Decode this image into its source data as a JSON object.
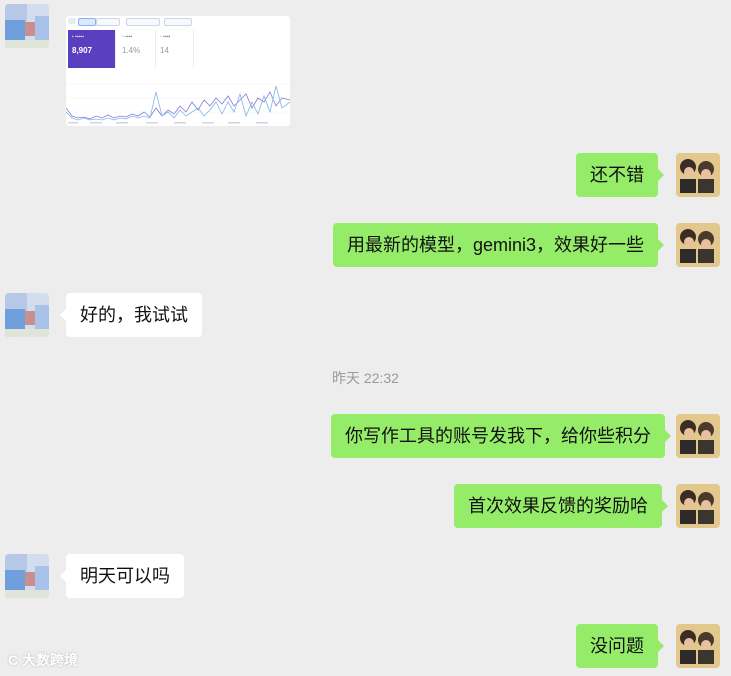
{
  "chat": {
    "messages": [
      {
        "id": 1,
        "side": "me",
        "text": "还不错"
      },
      {
        "id": 2,
        "side": "me",
        "text": "用最新的模型，gemini3，效果好一些"
      },
      {
        "id": 3,
        "side": "other",
        "text": "好的，我试试"
      },
      {
        "id": 4,
        "side": "me",
        "text": "你写作工具的账号发我下，给你些积分"
      },
      {
        "id": 5,
        "side": "me",
        "text": "首次效果反馈的奖励哈"
      },
      {
        "id": 6,
        "side": "other",
        "text": "明天可以吗"
      },
      {
        "id": 7,
        "side": "me",
        "text": "没问题"
      }
    ],
    "timestamp": "昨天 22:32"
  },
  "image_message": {
    "cards": [
      {
        "value": "8,907"
      },
      {
        "value": "1.4%"
      },
      {
        "value": "14"
      }
    ]
  },
  "watermark": "C 大数跨境",
  "colors": {
    "background": "#ededed",
    "my_bubble": "#95ec69",
    "other_bubble": "#ffffff",
    "timestamp": "#9a9a9a"
  }
}
